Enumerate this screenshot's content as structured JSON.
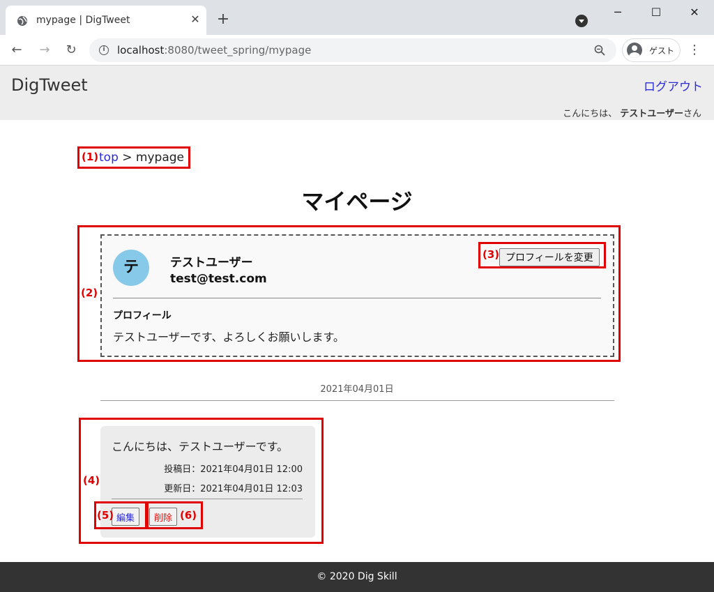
{
  "browser": {
    "tab_title": "mypage | DigTweet",
    "tab_close": "✕",
    "new_tab": "+",
    "url_host": "localhost",
    "url_path": ":8080/tweet_spring/mypage",
    "profile_label": "ゲスト",
    "minimize": "─",
    "maximize": "☐",
    "close": "✕",
    "back": "←",
    "forward": "→",
    "reload": "↻",
    "menu": "⋮"
  },
  "header": {
    "brand": "DigTweet",
    "logout": "ログアウト",
    "greeting_prefix": "こんにちは、",
    "greeting_user": "テストユーザー",
    "greeting_suffix": "さん"
  },
  "annotations": {
    "a1": "(1)",
    "a2": "(2)",
    "a3": "(3)",
    "a4": "(4)",
    "a5": "(5)",
    "a6": "(6)"
  },
  "breadcrumb": {
    "top": "top",
    "sep": " > ",
    "current": "mypage"
  },
  "page_title": "マイページ",
  "profile": {
    "avatar_initial": "テ",
    "name": "テストユーザー",
    "email": "test@test.com",
    "edit_button": "プロフィールを変更",
    "heading": "プロフィール",
    "text": "テストユーザーです、よろしくお願いします。"
  },
  "timeline": {
    "date_heading": "2021年04月01日",
    "tweets": [
      {
        "text": "こんにちは、テストユーザーです。",
        "posted": "投稿日：2021年04月01日 12:00",
        "updated": "更新日：2021年04月01日 12:03",
        "edit_label": "編集",
        "delete_label": "削除"
      }
    ]
  },
  "footer": "© 2020 Dig Skill",
  "colors": {
    "link": "#2b2bd8",
    "annotation": "#e00000",
    "avatar_bg": "#86c9e8",
    "footer_bg": "#333333"
  }
}
